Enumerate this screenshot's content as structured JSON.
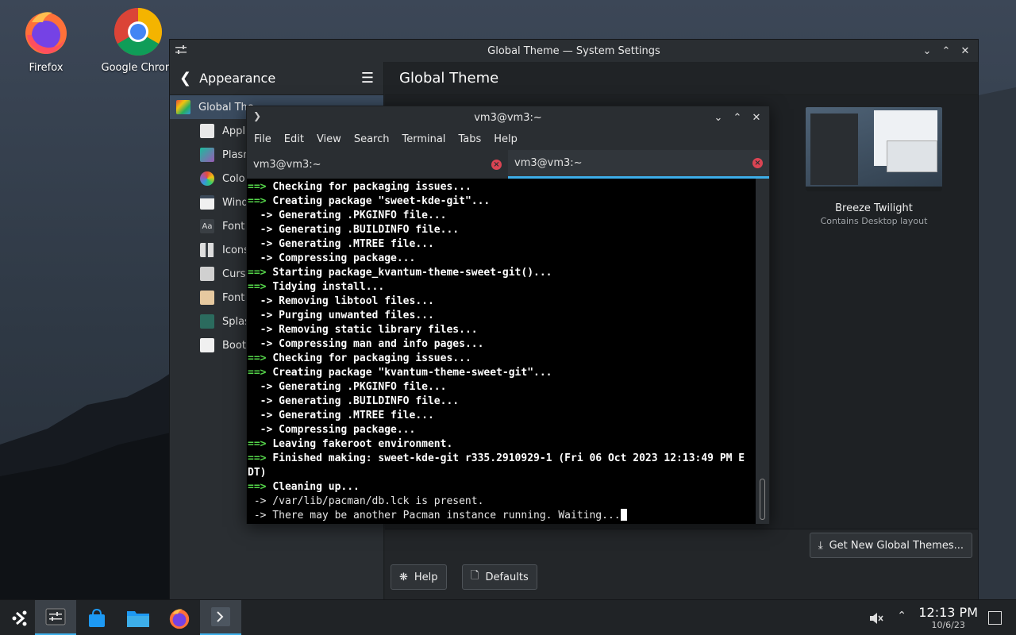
{
  "desktop": {
    "icons": [
      {
        "label": "Firefox",
        "icon": "firefox-icon"
      },
      {
        "label": "Google Chrom",
        "icon": "chrome-icon"
      }
    ]
  },
  "settings": {
    "title": "Global Theme — System Settings",
    "sidebar_header": "Appearance",
    "sidebar_items": [
      {
        "label": "Global The",
        "icon": "global-theme-icon"
      },
      {
        "label": "Appl",
        "icon": "application-style-icon"
      },
      {
        "label": "Plasn",
        "icon": "plasma-style-icon"
      },
      {
        "label": "Colo",
        "icon": "colors-icon"
      },
      {
        "label": "Wind",
        "icon": "window-decorations-icon"
      },
      {
        "label": "Font",
        "icon": "fonts-icon"
      },
      {
        "label": "Icons",
        "icon": "icons-icon"
      },
      {
        "label": "Curs",
        "icon": "cursors-icon"
      },
      {
        "label": "Font",
        "icon": "font-management-icon"
      },
      {
        "label": "Splas",
        "icon": "splash-screen-icon"
      },
      {
        "label": "Boot",
        "icon": "boot-splash-icon"
      }
    ],
    "page_title": "Global Theme",
    "theme_card": {
      "name": "Breeze Twilight",
      "subtitle": "Contains Desktop layout"
    },
    "get_new_label": "Get New Global Themes...",
    "help_label": "Help",
    "defaults_label": "Defaults"
  },
  "terminal": {
    "title": "vm3@vm3:~",
    "menu": [
      "File",
      "Edit",
      "View",
      "Search",
      "Terminal",
      "Tabs",
      "Help"
    ],
    "tabs": [
      {
        "label": "vm3@vm3:~",
        "active": false
      },
      {
        "label": "vm3@vm3:~",
        "active": true
      }
    ],
    "lines": [
      {
        "kind": "main",
        "text": "Checking for packaging issues..."
      },
      {
        "kind": "main",
        "text": "Creating package \"sweet-kde-git\"..."
      },
      {
        "kind": "sub",
        "text": "Generating .PKGINFO file..."
      },
      {
        "kind": "sub",
        "text": "Generating .BUILDINFO file..."
      },
      {
        "kind": "sub",
        "text": "Generating .MTREE file..."
      },
      {
        "kind": "sub",
        "text": "Compressing package..."
      },
      {
        "kind": "main",
        "text": "Starting package_kvantum-theme-sweet-git()..."
      },
      {
        "kind": "main",
        "text": "Tidying install..."
      },
      {
        "kind": "sub",
        "text": "Removing libtool files..."
      },
      {
        "kind": "sub",
        "text": "Purging unwanted files..."
      },
      {
        "kind": "sub",
        "text": "Removing static library files..."
      },
      {
        "kind": "sub",
        "text": "Compressing man and info pages..."
      },
      {
        "kind": "main",
        "text": "Checking for packaging issues..."
      },
      {
        "kind": "main",
        "text": "Creating package \"kvantum-theme-sweet-git\"..."
      },
      {
        "kind": "sub",
        "text": "Generating .PKGINFO file..."
      },
      {
        "kind": "sub",
        "text": "Generating .BUILDINFO file..."
      },
      {
        "kind": "sub",
        "text": "Generating .MTREE file..."
      },
      {
        "kind": "sub",
        "text": "Compressing package..."
      },
      {
        "kind": "main",
        "text": "Leaving fakeroot environment."
      },
      {
        "kind": "main",
        "text": "Finished making: sweet-kde-git r335.2910929-1 (Fri 06 Oct 2023 12:13:49 PM E"
      },
      {
        "kind": "cont",
        "text": "DT)"
      },
      {
        "kind": "main",
        "text": "Cleaning up..."
      },
      {
        "kind": "plain",
        "text": " -> /var/lib/pacman/db.lck is present."
      },
      {
        "kind": "plain",
        "text": " -> There may be another Pacman instance running. Waiting..."
      }
    ]
  },
  "taskbar": {
    "time": "12:13 PM",
    "date": "10/6/23"
  },
  "colors": {
    "accent": "#3daee9",
    "prompt_green": "#55d54a",
    "close_red": "#da4453"
  }
}
